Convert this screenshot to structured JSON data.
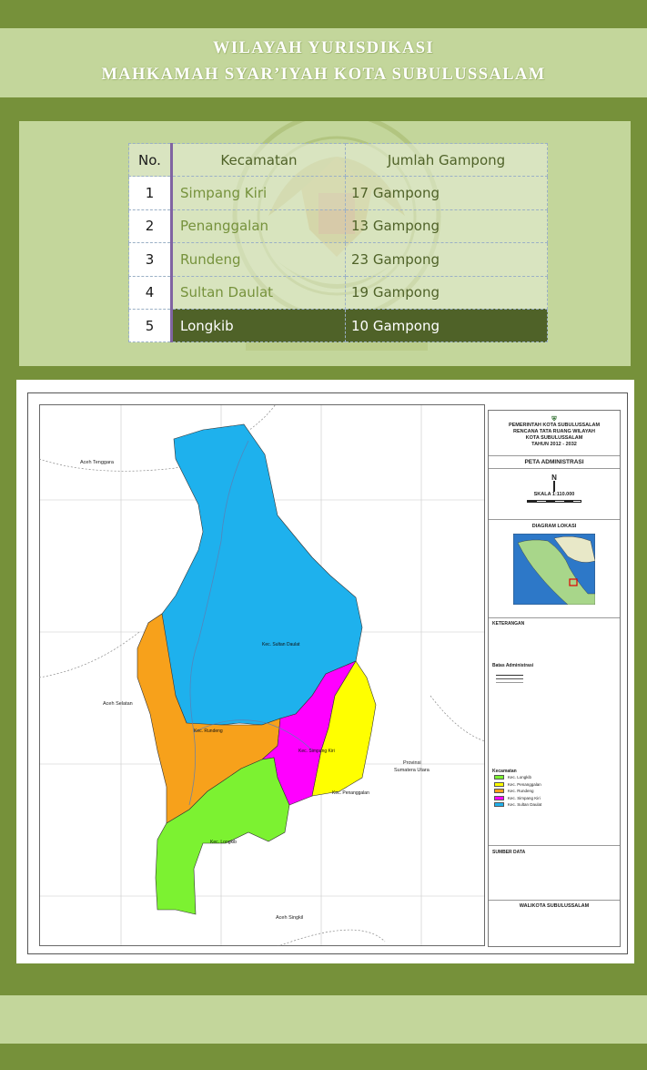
{
  "header": {
    "title_line1": "WILAYAH YURISDIKASI",
    "title_line2": "MAHKAMAH SYAR’IYAH KOTA  SUBULUSSALAM"
  },
  "table": {
    "columns": [
      "No.",
      "Kecamatan",
      "Jumlah Gampong"
    ],
    "rows": [
      {
        "no": "1",
        "kecamatan": "Simpang Kiri",
        "jumlah": "17 Gampong"
      },
      {
        "no": "2",
        "kecamatan": "Penanggalan",
        "jumlah": "13 Gampong"
      },
      {
        "no": "3",
        "kecamatan": "Rundeng",
        "jumlah": "23 Gampong"
      },
      {
        "no": "4",
        "kecamatan": "Sultan Daulat",
        "jumlah": "19 Gampong"
      },
      {
        "no": "5",
        "kecamatan": "Longkib",
        "jumlah": "10 Gampong"
      }
    ],
    "seal_text": "MAHKAMAH SYAR'IYAH KOTA SUBULUSSALAM"
  },
  "map": {
    "region_labels": {
      "aceh_tenggara": "Aceh Tenggara",
      "aceh_selatan": "Aceh Selatan",
      "aceh_singkil": "Aceh Singkil",
      "provinsi": "Provinsi",
      "sumatera_utara": "Sumatera Utara",
      "sultan_daulat": "Kec. Sultan Daulat",
      "rundeng": "Kec. Rundeng",
      "simpang_kiri": "Kec. Simpang Kiri",
      "penanggalan": "Kec. Penanggalan",
      "longkib": "Kec. Longkib"
    },
    "colors": {
      "sultan_daulat": "#1eb1ed",
      "rundeng": "#f7a11b",
      "simpang_kiri": "#ff00ff",
      "penanggalan": "#ffff00",
      "longkib": "#7cf231"
    },
    "sidebar": {
      "org": "PEMERINTAH KOTA SUBULUSSALAM",
      "plan_title": "RENCANA TATA RUANG WILAYAH",
      "city": "KOTA SUBULUSSALAM",
      "years": "TAHUN 2012 - 2032",
      "map_title": "PETA ADMINISTRASI",
      "north": "N",
      "scale": "SKALA 1:110.000",
      "inset_title": "DIAGRAM LOKASI",
      "legend_title": "KETERANGAN",
      "admin_title": "Batas Administrasi",
      "kecamatan_title": "Kecamatan",
      "legend": [
        {
          "label": "Kec. Longkib",
          "color": "#7cf231"
        },
        {
          "label": "Kec. Penanggalan",
          "color": "#ffff00"
        },
        {
          "label": "Kec. Rundeng",
          "color": "#f7a11b"
        },
        {
          "label": "Kec. Simpang Kiri",
          "color": "#ff00ff"
        },
        {
          "label": "Kec. Sultan Daulat",
          "color": "#1eb1ed"
        }
      ],
      "source_title": "SUMBER DATA",
      "signature": "WALIKOTA SUBULUSSALAM"
    }
  }
}
